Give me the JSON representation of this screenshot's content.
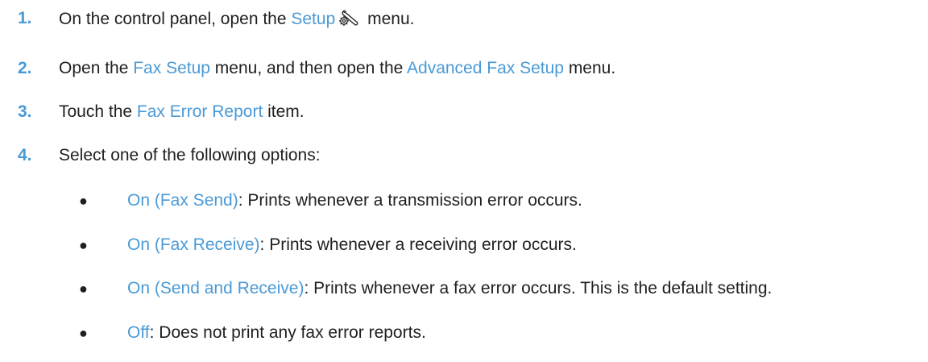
{
  "steps": [
    {
      "number": "1.",
      "before": "On the control panel, open the ",
      "link": "Setup",
      "icon": "setup-wrench-gear-icon",
      "after": " menu."
    },
    {
      "number": "2.",
      "before": "Open the ",
      "link1": "Fax Setup",
      "middle": " menu, and then open the ",
      "link2": "Advanced Fax Setup",
      "after": " menu."
    },
    {
      "number": "3.",
      "before": "Touch the ",
      "link": "Fax Error Report",
      "after": " item."
    },
    {
      "number": "4.",
      "text": "Select one of the following options:"
    }
  ],
  "options": [
    {
      "bullet": "●",
      "label": "On (Fax Send)",
      "description": ": Prints whenever a transmission error occurs."
    },
    {
      "bullet": "●",
      "label": "On (Fax Receive)",
      "description": ": Prints whenever a receiving error occurs."
    },
    {
      "bullet": "●",
      "label": "On (Send and Receive)",
      "description": ": Prints whenever a fax error occurs. This is the default setting."
    },
    {
      "bullet": "●",
      "label": "Off",
      "description": ": Does not print any fax error reports."
    }
  ],
  "colors": {
    "accent": "#4a9ad6",
    "text": "#1f1f1f",
    "background": "#ffffff"
  }
}
